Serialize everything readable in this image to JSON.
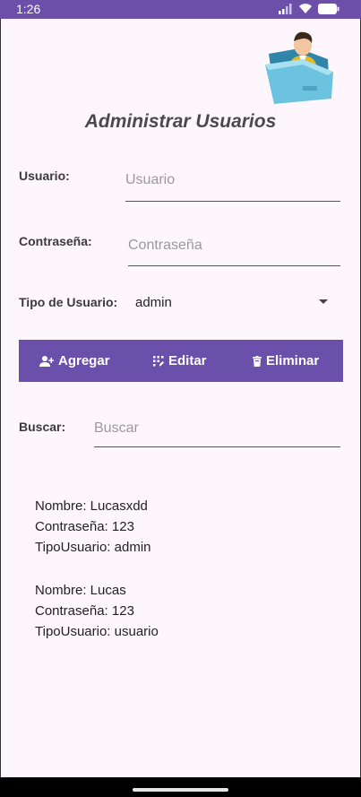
{
  "status_bar": {
    "time": "1:26"
  },
  "header": {
    "title": "Administrar Usuarios"
  },
  "form": {
    "usuario": {
      "label": "Usuario:",
      "placeholder": "Usuario",
      "value": ""
    },
    "password": {
      "label": "Contraseña:",
      "placeholder": "Contraseña",
      "value": ""
    },
    "tipo": {
      "label": "Tipo de Usuario:",
      "selected": "admin"
    }
  },
  "actions": {
    "add_label": "Agregar",
    "edit_label": "Editar",
    "delete_label": "Eliminar"
  },
  "search": {
    "label": "Buscar:",
    "placeholder": "Buscar",
    "value": ""
  },
  "users": [
    {
      "nombre": "Nombre: Lucasxdd",
      "contrasena": "Contraseña: 123",
      "tipo": "TipoUsuario: admin"
    },
    {
      "nombre": "Nombre: Lucas",
      "contrasena": "Contraseña: 123",
      "tipo": "TipoUsuario: usuario"
    }
  ],
  "colors": {
    "accent": "#6a4fab",
    "background": "#fdf7fd"
  }
}
